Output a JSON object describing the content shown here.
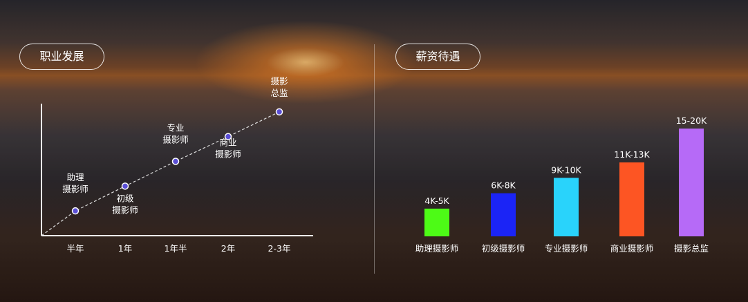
{
  "sections": {
    "career_title": "职业发展",
    "salary_title": "薪资待遇"
  },
  "chart_data": [
    {
      "type": "line",
      "categories": [
        "半年",
        "1年",
        "1年半",
        "2年",
        "2-3年"
      ],
      "points": [
        {
          "x": "半年",
          "y": 1,
          "label": "助理\n摄影师"
        },
        {
          "x": "1年",
          "y": 2,
          "label": "初级\n摄影师"
        },
        {
          "x": "1年半",
          "y": 3,
          "label": "专业\n摄影师"
        },
        {
          "x": "2年",
          "y": 4,
          "label": "商业\n摄影师"
        },
        {
          "x": "2-3年",
          "y": 5,
          "label": "摄影\n总监"
        }
      ],
      "ylim": [
        0,
        6
      ],
      "grid": false,
      "line_style": "dashed",
      "colors": {
        "line": "#dddddd",
        "marker_fill": "#5b4fd6",
        "marker_stroke": "#ffffff"
      }
    },
    {
      "type": "bar",
      "categories": [
        "助理摄影师",
        "初级摄影师",
        "专业摄影师",
        "商业摄影师",
        "摄影总监"
      ],
      "value_labels": [
        "4K-5K",
        "6K-8K",
        "9K-10K",
        "11K-13K",
        "15-20K"
      ],
      "values": [
        4.5,
        7,
        9.5,
        12,
        17.5
      ],
      "colors": [
        "#4dfb16",
        "#1b24f6",
        "#29d3fb",
        "#fd5523",
        "#b66af7"
      ],
      "grid": false
    }
  ]
}
